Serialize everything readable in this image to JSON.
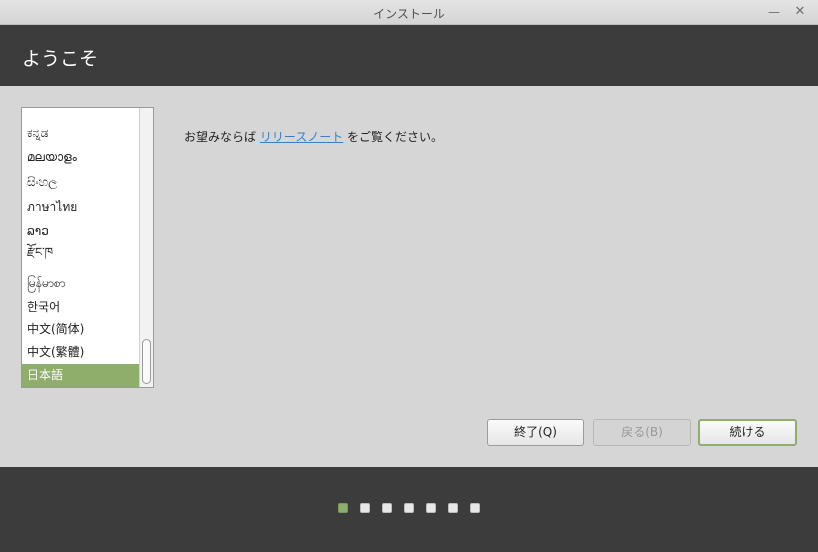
{
  "window": {
    "title": "インストール",
    "minimize_glyph": "—",
    "close_glyph": "✕"
  },
  "header": {
    "title": "ようこそ"
  },
  "language_list": {
    "items": [
      "ಕನ್ನಡ",
      "മലയാളം",
      "සිංහල",
      "ภาษาไทย",
      "ລາວ",
      "རྫོང་ཁ",
      "မြန်မာစာ",
      "한국어",
      "中文(简体)",
      "中文(繁體)",
      "日本語"
    ],
    "selected": "日本語"
  },
  "release_notes": {
    "prefix": "お望みならば ",
    "link": "リリースノート",
    "suffix": " をご覧ください。"
  },
  "buttons": {
    "quit": "終了(Q)",
    "back": "戻る(B)",
    "continue": "続ける"
  },
  "progress": {
    "total_steps": 7,
    "current_step": 1
  },
  "colors": {
    "accent": "#8fae6b",
    "header_bg": "#3c3c3c",
    "link": "#3b7fc4"
  }
}
